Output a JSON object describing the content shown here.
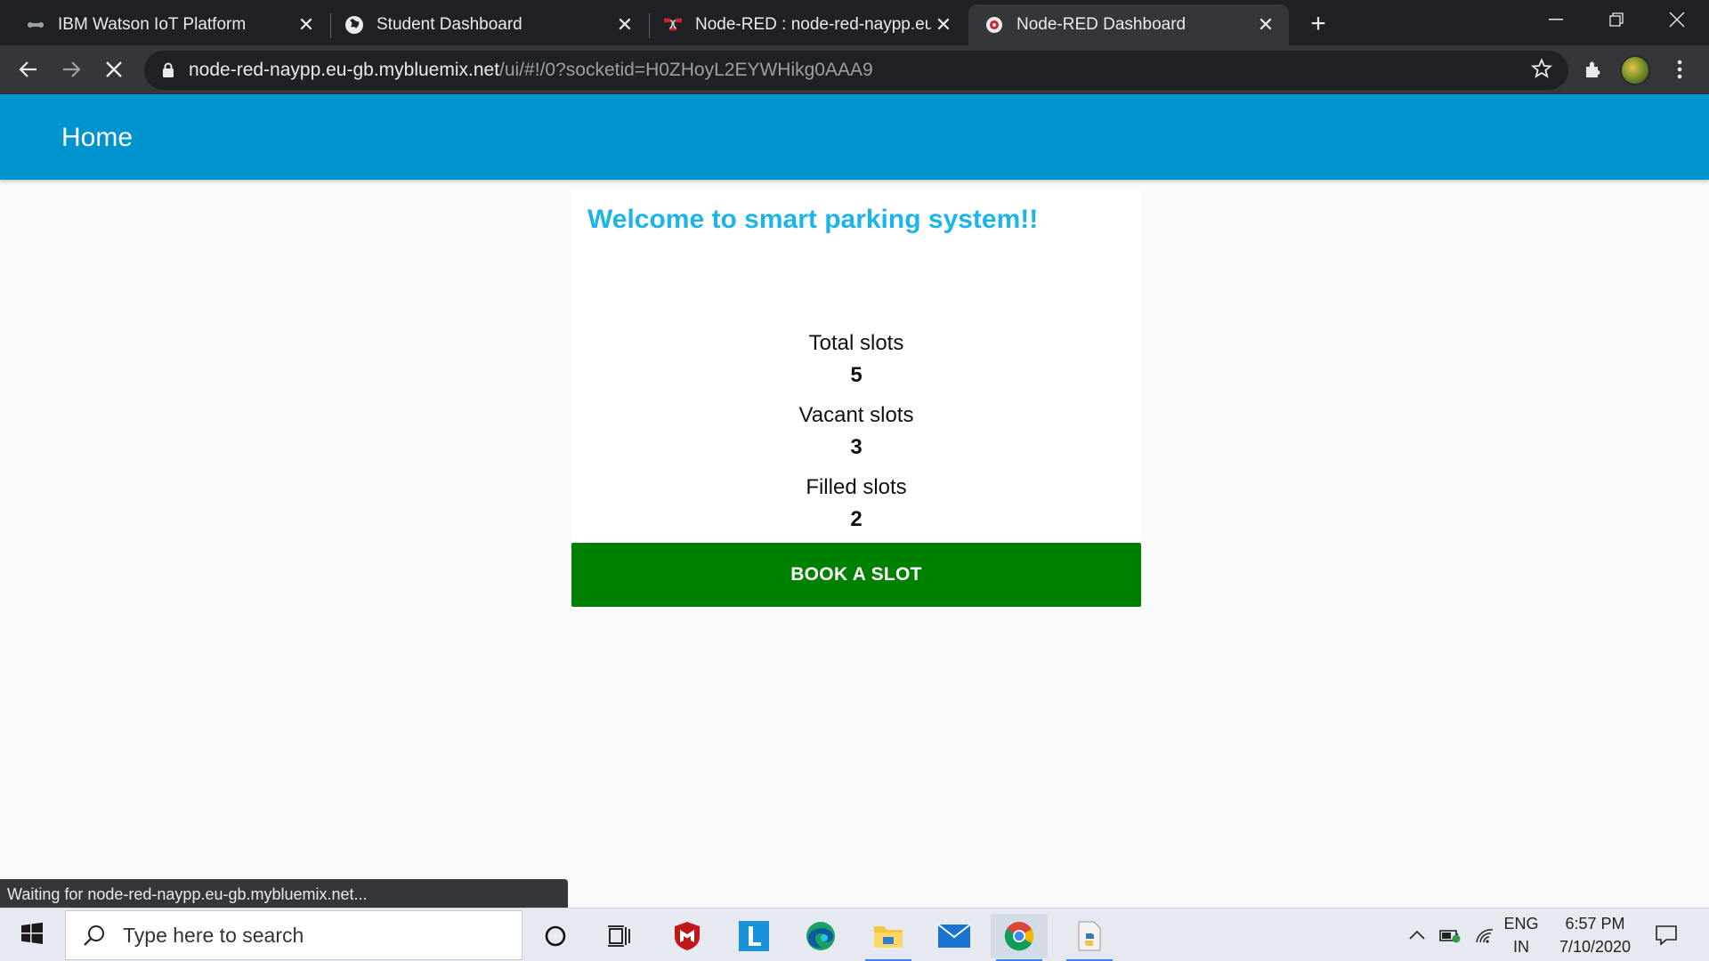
{
  "browser": {
    "tabs": [
      {
        "title": "IBM Watson IoT Platform",
        "icon": "ibm-watson-icon",
        "active": false
      },
      {
        "title": "Student Dashboard",
        "icon": "globe-icon",
        "active": false
      },
      {
        "title": "Node-RED : node-red-naypp.eu-",
        "icon": "node-red-icon",
        "active": false
      },
      {
        "title": "Node-RED Dashboard",
        "icon": "node-red-dashboard-icon",
        "active": true
      }
    ],
    "url_host": "node-red-naypp.eu-gb.mybluemix.net",
    "url_path": "/ui/#!/0?socketid=H0ZHoyL2EYWHikg0AAA9",
    "status_text": "Waiting for node-red-naypp.eu-gb.mybluemix.net..."
  },
  "page": {
    "appbar_title": "Home",
    "welcome": "Welcome to smart parking system!!",
    "stats": [
      {
        "label": "Total slots",
        "value": "5"
      },
      {
        "label": "Vacant slots",
        "value": "3"
      },
      {
        "label": "Filled slots",
        "value": "2"
      }
    ],
    "book_button": "BOOK A SLOT",
    "colors": {
      "appbar": "#0094ce",
      "welcome": "#1bb4ec",
      "button": "#008000"
    }
  },
  "taskbar": {
    "search_placeholder": "Type here to search",
    "lang_line1": "ENG",
    "lang_line2": "IN",
    "time": "6:57 PM",
    "date": "7/10/2020"
  }
}
